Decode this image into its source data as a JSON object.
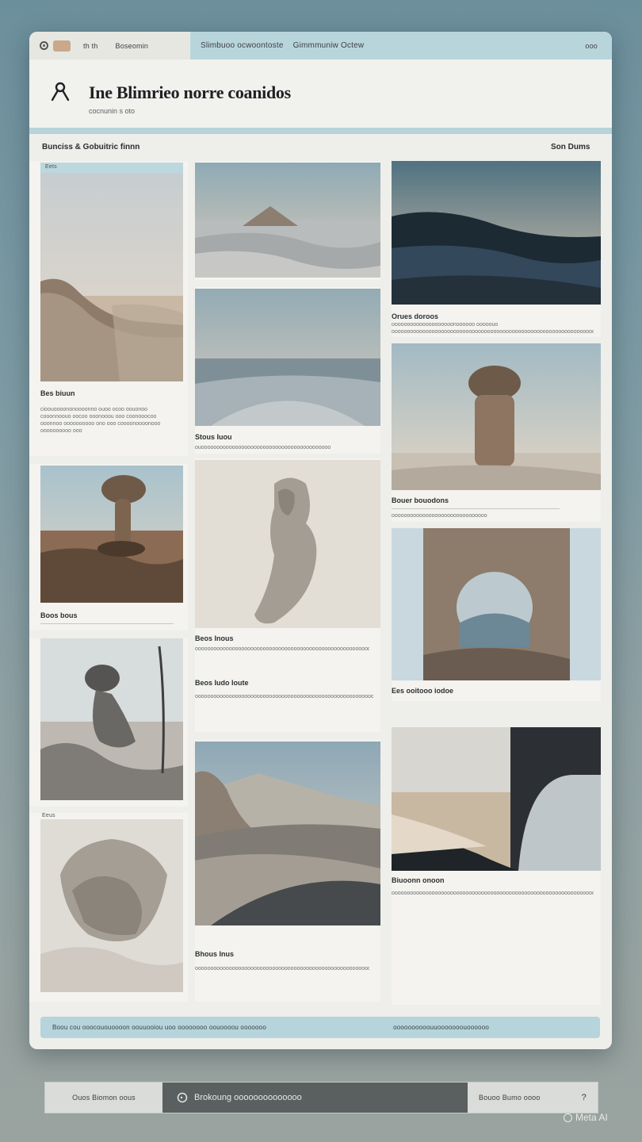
{
  "window": {
    "topbar": {
      "nav_short": "th th",
      "nav_label": "Boseomin",
      "breadcrumb": "Slimbuoo ocwoontoste",
      "breadcrumb_2": "Gimmmuniw Octew",
      "action": "ooo"
    },
    "header": {
      "title": "Ine Blimrieo norre coanidos",
      "subtitle": "cocnunin s oto"
    },
    "sections": {
      "left_heading": "Bunciss & Gobuitric finnn",
      "right_heading": "Son Dums"
    },
    "cards": [
      {
        "tag": "Eets",
        "caption": "Bes biuun",
        "text": "cioouoooononoooonno ouoo ocoo oouonoo cooonnoouo oocoo ooonooou ooo coonooocoo ooonnoo oooooooooo ono ooo coooonoooonooo oooooooooo ooo"
      },
      {
        "caption": "Stous Iuou",
        "text": "ouoooooooooooooooooooooooooooooooooooooooooo"
      },
      {
        "caption": "Orues doroos",
        "text": "oooooooooooooooooooonoooooo ooooouo ooooooooooooooooooooooooooooooooooooooooooooooooooooooooooooooooooooooo ooooooooooo"
      },
      {
        "caption": "Boos bous",
        "text": ""
      },
      {
        "caption": "Bouer bouodons",
        "text": "ooooooooooooooooooooooooooooooo"
      },
      {
        "caption": "Beos Inous",
        "text": "oooooooooooooooooooooooooooooooooooooooooooooooooooooooooooooooooooooooooooo"
      },
      {
        "caption": "Beos Iudo Ioute",
        "text": "oooooooooooooooooooooooooooooooooooooooooooooooooooooooooooooooooooooooooooooooooooooooooooooooooooooooooooooooooooooooooo"
      },
      {
        "caption": "Bhous Inus",
        "text": "ooooooooooooooooooooooooooooooooooooooooooooooooooooooooooooooooooooo"
      },
      {
        "tag": "Eeus",
        "caption": "Ees ooitooo iodoe",
        "text": "ooooooooooooooooooooooooooooooooooooooooooooooooooooooooooooooooooooooooooooooooooooooooooooooooooooooooooo"
      },
      {
        "caption": "Biuoonn onoon",
        "text": "ooooooooooooooooooooooooooooooooooooooooooooooooooooooooooooooooooooooooooooooooooooooooooooooooooooooooooooooooooooooooooooooooooooooooooooooooooooooooooooooooooooooooooooooooooooooooooo"
      }
    ],
    "footer": {
      "left": "Boou cou ooocououoooon oouuooiou uoo oooooooo oouoooou ooooooo",
      "right": "oooooooooouuooooooouoooooo"
    }
  },
  "bottom_bar": {
    "left": "Ouos Biomon oous",
    "search_icon": "search-icon",
    "middle": "Brokoung oooooooooooooo",
    "right": "Bouoo Bumo oooo",
    "help": "?"
  },
  "watermark": "Meta AI",
  "colors": {
    "accent_blue": "#b9d5dc",
    "page_bg": "#eeeeea",
    "dark_bar": "#5a605f"
  }
}
